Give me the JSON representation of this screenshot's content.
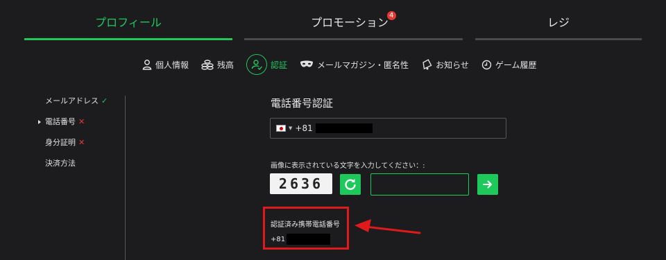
{
  "tabs": [
    {
      "label": "プロフィール",
      "active": true
    },
    {
      "label": "プロモーション",
      "badge": "4"
    },
    {
      "label": "レジ"
    }
  ],
  "subnav": [
    {
      "label": "個人情報",
      "icon": "person-icon"
    },
    {
      "label": "残高",
      "icon": "coins-icon"
    },
    {
      "label": "認証",
      "icon": "verify-icon",
      "active": true
    },
    {
      "label": "メールマガジン・匿名性",
      "icon": "mask-icon"
    },
    {
      "label": "お知らせ",
      "icon": "bell-icon"
    },
    {
      "label": "ゲーム履歴",
      "icon": "clock-icon"
    }
  ],
  "sidemenu": [
    {
      "label": "メールアドレス",
      "status": "✓"
    },
    {
      "label": "電話番号",
      "status": "✕",
      "current": true
    },
    {
      "label": "身分証明",
      "status": "✕"
    },
    {
      "label": "決済方法"
    }
  ],
  "main": {
    "title": "電話番号認証",
    "phone_prefix": "+81",
    "captcha_label": "画像に表示されている文字を入力してください：:",
    "captcha_text": "2636",
    "captcha_value": "",
    "verified_label": "認証済み携帯電話番号",
    "verified_prefix": "+81"
  },
  "colors": {
    "accent": "#1ec95c",
    "error": "#e53935",
    "highlight": "#e01a1a",
    "background": "#1c1c1f"
  }
}
